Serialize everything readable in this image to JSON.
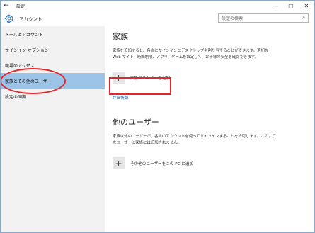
{
  "titlebar": {
    "back_icon": "back-arrow-icon",
    "title": "設定",
    "minimize": "—",
    "maximize": "□",
    "close": "✕"
  },
  "header": {
    "icon": "gear-icon",
    "title": "アカウント",
    "search_placeholder": "設定の検索",
    "search_icon": "search-icon"
  },
  "sidebar": {
    "items": [
      {
        "label": "メールとアカウント",
        "selected": false
      },
      {
        "label": "サインイン オプション",
        "selected": false
      },
      {
        "label": "職場のアクセス",
        "selected": false
      },
      {
        "label": "家族とその他のユーザー",
        "selected": true
      },
      {
        "label": "設定の同期",
        "selected": false
      }
    ]
  },
  "main": {
    "family": {
      "title": "家族",
      "description": "家族を追加すると、各自にサインインとデスクトップを割り当てることができます。適切な Web サイト、時間制限、アプリ、ゲームを設定して、お子様の安全を確保できます。",
      "add_label": "家族のメンバーを追加",
      "link": "詳細情報"
    },
    "others": {
      "title": "他のユーザー",
      "description": "家族以外のユーザーが、各自のアカウントを使ってサインインすることを許可します。このようなユーザーは家族には追加されません。",
      "add_label": "その他のユーザーをこの PC に追加"
    }
  },
  "annotation_color": "#e3262b",
  "selected_color": "#9cc3e8"
}
